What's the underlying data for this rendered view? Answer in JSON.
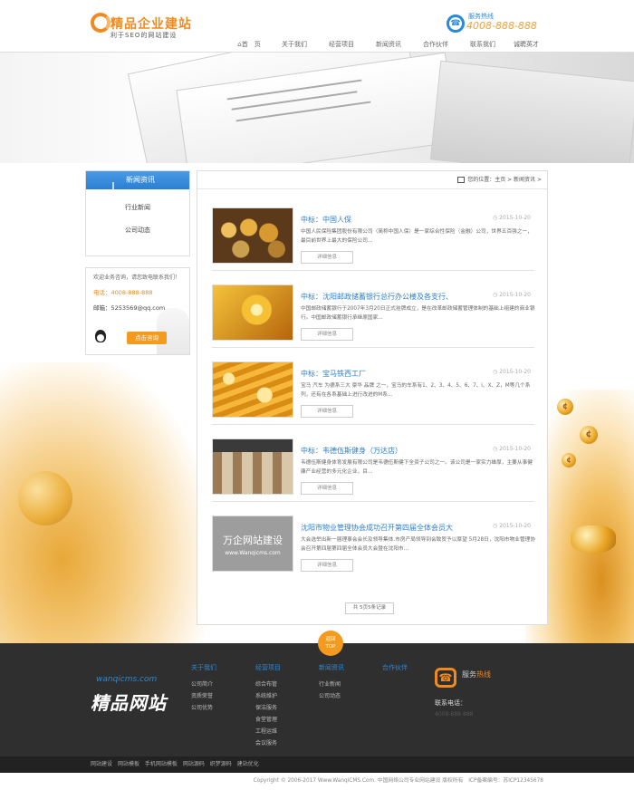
{
  "header": {
    "logo_name": "精品企业建站",
    "logo_sub": "利于SEO的网站建设",
    "hotline_label": "服务热线",
    "hotline_number": "4008-888-888"
  },
  "nav": {
    "items": [
      "首　页",
      "关于我们",
      "经营项目",
      "新闻资讯",
      "合作伙伴",
      "联系我们",
      "诚聘英才"
    ]
  },
  "sidebar": {
    "title": "新闻资讯",
    "items": [
      "行业新闻",
      "公司动态"
    ]
  },
  "contact": {
    "intro": "欢迎业务咨询，请您致电联系我们！",
    "tel": "电话：4008-888-888",
    "mail": "邮箱：5253569@qq.com",
    "button": "点击咨询"
  },
  "breadcrumb": "您的位置：主页 > 新闻资讯 >",
  "news": [
    {
      "title": "中标：中国人保",
      "date": "2015-10-20",
      "desc": "中国人民保险集团股份有限公司（简称中国人保）是一家综合性保险（金融）公司，世界五百强之一，最目前世界上最大的保险公司...",
      "more": "详细信息"
    },
    {
      "title": "中标：沈阳邮政储蓄银行总行办公楼及各支行、",
      "date": "2015-10-20",
      "desc": "中国邮政储蓄银行于2007年3月20日正式挂牌成立，是在改革邮政储蓄管理体制的基础上组建的商业银行。中国邮政储蓄银行承继原国家...",
      "more": "详细信息"
    },
    {
      "title": "中标：宝马铁西工厂",
      "date": "2015-10-20",
      "desc": "宝马 汽车 为德系三大 豪华 品牌 之一，宝马的车系有1、2、3、4、5、6、7、i、X、Z，M等几个系列，还有在各系基础上进行改进的M系...",
      "more": "详细信息"
    },
    {
      "title": "中标：韦德伍斯健身（万达店）",
      "date": "2015-10-20",
      "desc": "韦德伍斯健身体育发展有限公司是韦德伍斯健下全资子公司之一。该公司是一家实力雄厚，主要从事健康产业经营的多元化企业，目...",
      "more": "详细信息"
    },
    {
      "title": "沈阳市物业管理协会成功召开第四届全体会员大",
      "date": "2015-10-20",
      "desc": "大会选举出新一届理事会会长及领导集体.市房产局领导到会致贺予以厚望 5月28日，沈阳市物业管理协会召开第四届第四届全体会员大会暨在沈阳市...",
      "more": "详细信息",
      "thumb_text": "万企网站建设",
      "thumb_url": "www.Wanqicms.com"
    }
  ],
  "pager": "共 5页5条记录",
  "top_button": [
    "返回",
    "TOP"
  ],
  "footer": {
    "logo_en": "wanqicms.com",
    "logo_cn": "精品网站",
    "columns": [
      {
        "title": "关于我们",
        "items": [
          "公司简介",
          "资质荣誉",
          "公司优势"
        ]
      },
      {
        "title": "经营项目",
        "items": [
          "综合布管",
          "系统维护",
          "保洁服务",
          "食堂管理",
          "工程运维",
          "会议服务"
        ]
      },
      {
        "title": "新闻资讯",
        "items": [
          "行业新闻",
          "公司动态"
        ]
      },
      {
        "title": "合作伙伴",
        "items": []
      }
    ],
    "hotline_title_a": "服务",
    "hotline_title_b": "热线",
    "contact_label": "联系电话：",
    "contact_number": "4008-888-888",
    "links": [
      "网站建设",
      "网站模板",
      "手机网站模板",
      "网站源码",
      "织梦源码",
      "建站优化"
    ],
    "copyright": "Copyright © 2006-2017 Www.WanqiCMS.Com. 中国网络公司专业网站建设 版权所有　ICP备案编号：苏ICP12345678"
  },
  "colors": {
    "accent": "#f08a1e",
    "blue": "#2a7fd0",
    "footer_bg": "#2f2f2f"
  }
}
